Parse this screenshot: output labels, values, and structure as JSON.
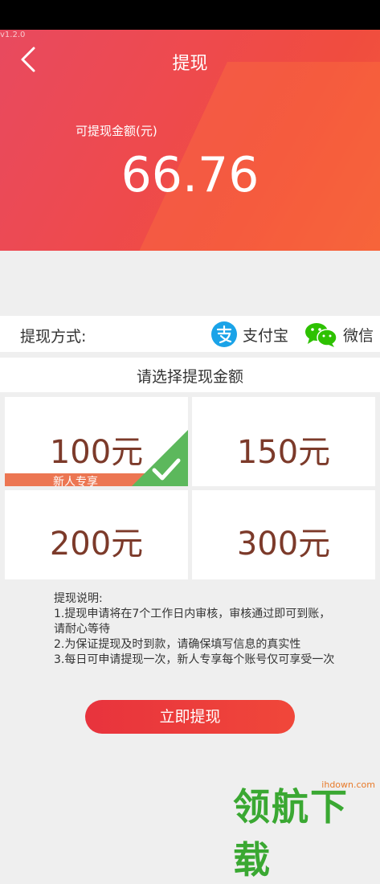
{
  "app": {
    "version": "v1.2.0"
  },
  "header": {
    "title": "提现",
    "balance_label": "可提现金额(元)",
    "balance": "66.76"
  },
  "payment": {
    "label": "提现方式:",
    "options": [
      {
        "label": "支付宝",
        "icon": "alipay-icon",
        "color": "#1aa3e8"
      },
      {
        "label": "微信",
        "icon": "wechat-icon",
        "color": "#2dc100"
      }
    ]
  },
  "amounts": {
    "title": "请选择提现金额",
    "options": [
      {
        "label": "100元",
        "badge": "新人专享",
        "selected": true
      },
      {
        "label": "150元"
      },
      {
        "label": "200元"
      },
      {
        "label": "300元"
      }
    ]
  },
  "notes": {
    "heading": "提现说明:",
    "lines": [
      "1.提现申请将在7个工作日内审核，审核通过即可到账，请耐心等待",
      "2.为保证提现及时到款，请确保填写信息的真实性",
      "3.每日可申请提现一次，新人专享每个账号仅可享受一次"
    ]
  },
  "submit_label": "立即提现",
  "watermark": {
    "site": "ihdown.com",
    "logo": "领航下载"
  }
}
